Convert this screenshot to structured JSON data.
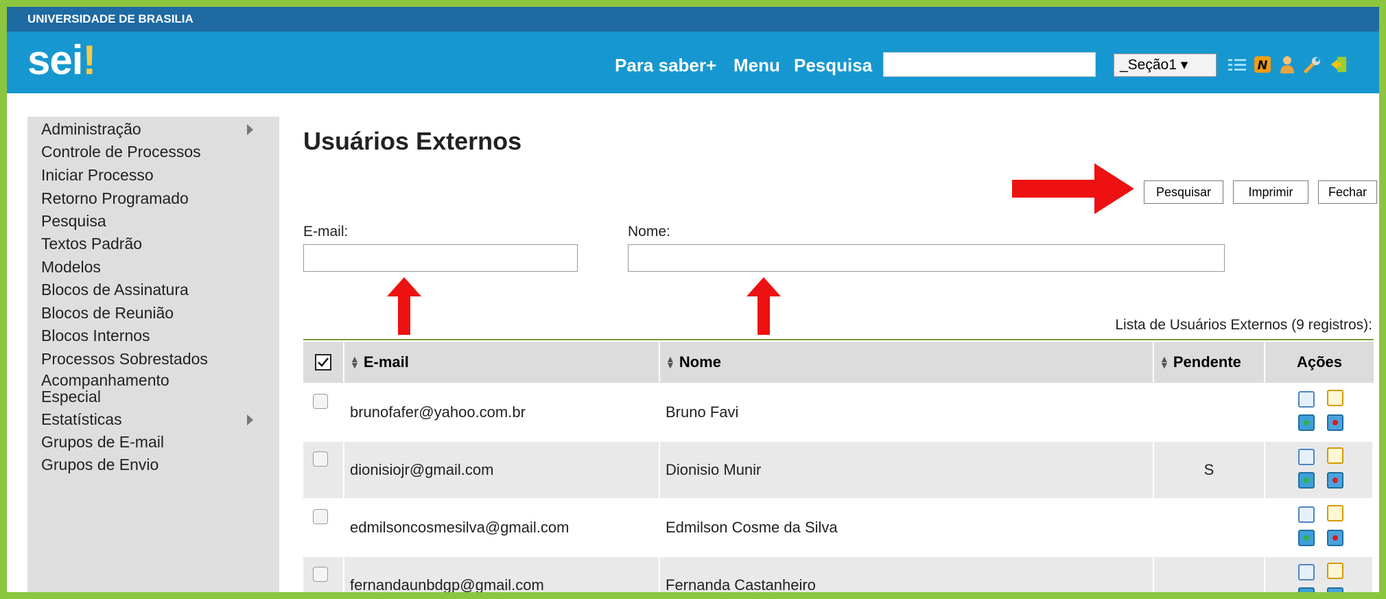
{
  "header": {
    "institution": "UNIVERSIDADE DE BRASILIA",
    "logo_text": "sei",
    "logo_mark": "!",
    "links": [
      "Para saber+",
      "Menu",
      "Pesquisa"
    ],
    "unit_select": "_Seção1 ▾",
    "icons": [
      "list-icon",
      "notes-icon",
      "user-icon",
      "wrench-icon",
      "exit-icon"
    ]
  },
  "sidebar": {
    "items": [
      {
        "label": "Administração",
        "has_submenu": true
      },
      {
        "label": "Controle de Processos"
      },
      {
        "label": "Iniciar Processo"
      },
      {
        "label": "Retorno Programado"
      },
      {
        "label": "Pesquisa"
      },
      {
        "label": "Textos Padrão"
      },
      {
        "label": "Modelos"
      },
      {
        "label": "Blocos de Assinatura"
      },
      {
        "label": "Blocos de Reunião"
      },
      {
        "label": "Blocos Internos"
      },
      {
        "label": "Processos Sobrestados"
      },
      {
        "label": "Acompanhamento Especial"
      },
      {
        "label": "Estatísticas",
        "has_submenu": true
      },
      {
        "label": "Grupos de E-mail"
      },
      {
        "label": "Grupos de Envio"
      }
    ]
  },
  "main": {
    "title": "Usuários Externos",
    "buttons": {
      "search": "Pesquisar",
      "print": "Imprimir",
      "close": "Fechar"
    },
    "filters": {
      "email_label": "E-mail:",
      "email_value": "",
      "name_label": "Nome:",
      "name_value": ""
    },
    "list_caption": "Lista de Usuários Externos (9 registros):"
  },
  "table": {
    "headers": [
      "E-mail",
      "Nome",
      "Pendente",
      "Ações"
    ],
    "rows": [
      {
        "email": "brunofafer@yahoo.com.br",
        "name": "Bruno Favi",
        "pending": ""
      },
      {
        "email": "dionisiojr@gmail.com",
        "name": "Dionisio Munir",
        "pending": "S"
      },
      {
        "email": "edmilsoncosmesilva@gmail.com",
        "name": "Edmilson Cosme da Silva",
        "pending": ""
      },
      {
        "email": "fernandaunbdgp@gmail.com",
        "name": "Fernanda Castanheiro",
        "pending": ""
      }
    ]
  },
  "colors": {
    "frame": "#8cc63f",
    "institution_bar": "#1e6aa3",
    "header_bar": "#1797d0",
    "sidebar": "#dedede",
    "row_alt": "#e9e9e9",
    "annotation_arrow": "#ee1111"
  }
}
